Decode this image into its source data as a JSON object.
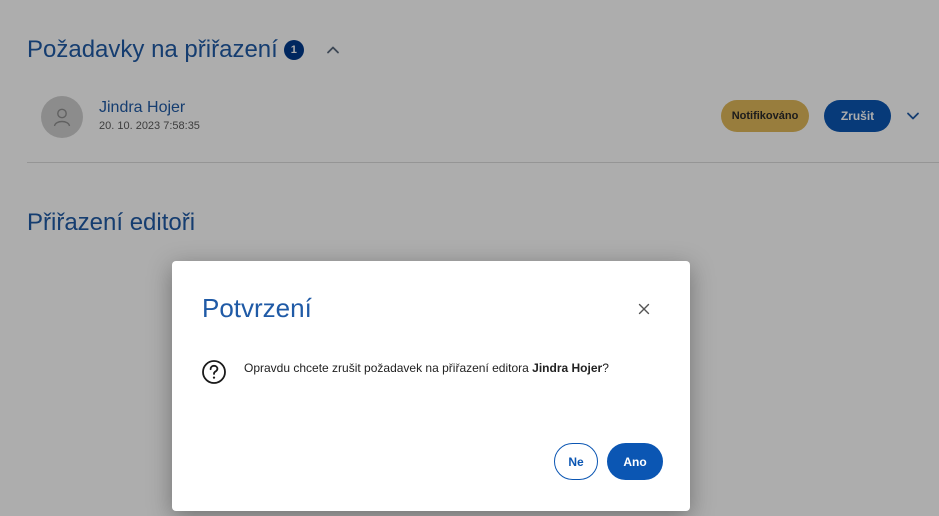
{
  "requests_section": {
    "title": "Požadavky na přiřazení",
    "count": "1"
  },
  "request": {
    "user_name": "Jindra Hojer",
    "timestamp": "20. 10. 2023 7:58:35",
    "status": "Notifikováno",
    "cancel_label": "Zrušit"
  },
  "editors_section": {
    "title": "Přiřazení editoři"
  },
  "dialog": {
    "title": "Potvrzení",
    "message_prefix": "Opravdu chcete zrušit požadavek na přiřazení editora ",
    "message_name": "Jindra Hojer",
    "message_suffix": "?",
    "no_label": "Ne",
    "yes_label": "Ano"
  },
  "colors": {
    "primary": "#0b56b3",
    "title_blue": "#1f5aa6",
    "status_badge": "#e0b85a",
    "overlay": "rgba(0,0,0,0.32)"
  },
  "icons": {
    "collapse": "chevron-up-icon",
    "expand": "chevron-down-icon",
    "avatar": "person-icon",
    "close": "close-icon",
    "question": "question-circle-icon"
  }
}
